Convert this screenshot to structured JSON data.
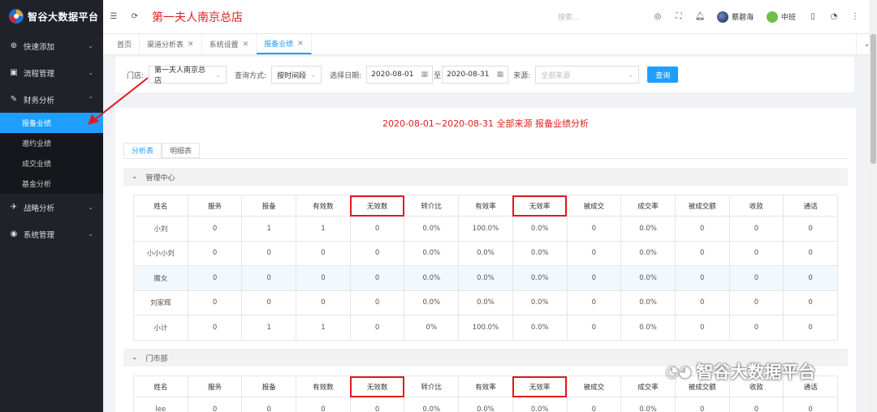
{
  "app": {
    "logo_text": "智谷大数据平台"
  },
  "sidebar": {
    "items": [
      {
        "label": "快速添加",
        "icon": "plus-circle-icon"
      },
      {
        "label": "流程管理",
        "icon": "camera-icon"
      },
      {
        "label": "财务分析",
        "icon": "edit-icon",
        "expanded": true,
        "children": [
          "报备业绩",
          "邀约业绩",
          "成交业绩",
          "基金分析"
        ],
        "active_child": "报备业绩"
      },
      {
        "label": "战略分析",
        "icon": "plane-icon"
      },
      {
        "label": "系统管理",
        "icon": "globe-icon"
      }
    ]
  },
  "header": {
    "store_title": "第一夫人南京总店",
    "search_placeholder": "搜索...",
    "user_name": "蔡碧海",
    "shift_label": "中班"
  },
  "tabs": [
    {
      "label": "首页",
      "closable": false,
      "active": false
    },
    {
      "label": "渠道分析表",
      "closable": true,
      "active": false
    },
    {
      "label": "系统设置",
      "closable": true,
      "active": false
    },
    {
      "label": "报备业绩",
      "closable": true,
      "active": true
    }
  ],
  "filter": {
    "store_label": "门店:",
    "store_value": "第一夫人南京总店",
    "query_mode_label": "查询方式:",
    "query_mode_value": "按时间段",
    "date_label": "选择日期:",
    "date_from": "2020-08-01",
    "date_to_sep": "至",
    "date_to": "2020-08-31",
    "source_label": "来源:",
    "source_placeholder": "全部来源",
    "query_button": "查询"
  },
  "report": {
    "title": "2020-08-01~2020-08-31 全部来源 报备业绩分析",
    "sub_tabs": [
      "分析表",
      "明细表"
    ],
    "active_sub_tab": "分析表",
    "columns": [
      "姓名",
      "服务",
      "报备",
      "有效数",
      "无效数",
      "转介比",
      "有效率",
      "无效率",
      "被成交",
      "成交率",
      "被成交额",
      "收款",
      "通话"
    ],
    "highlighted_columns": [
      "无效数",
      "无效率"
    ],
    "sections": [
      {
        "name": "管理中心",
        "rows": [
          [
            "小刘",
            "0",
            "1",
            "1",
            "0",
            "0.0%",
            "100.0%",
            "0.0%",
            "0",
            "0.0%",
            "0",
            "0",
            "0"
          ],
          [
            "小小小刘",
            "0",
            "0",
            "0",
            "0",
            "0.0%",
            "0.0%",
            "0.0%",
            "0",
            "0.0%",
            "0",
            "0",
            "0"
          ],
          [
            "魔女",
            "0",
            "0",
            "0",
            "0",
            "0.0%",
            "0.0%",
            "0.0%",
            "0",
            "0.0%",
            "0",
            "0",
            "0"
          ],
          [
            "刘家辉",
            "0",
            "0",
            "0",
            "0",
            "0.0%",
            "0.0%",
            "0.0%",
            "0",
            "0.0%",
            "0",
            "0",
            "0"
          ],
          [
            "小计",
            "0",
            "1",
            "1",
            "0",
            "0%",
            "100.0%",
            "0.0%",
            "0",
            "0.0%",
            "0",
            "0",
            "0"
          ]
        ]
      },
      {
        "name": "门市部",
        "rows": [
          [
            "lee",
            "0",
            "0",
            "0",
            "0",
            "0.0%",
            "0.0%",
            "0.0%",
            "0",
            "0.0%",
            "0",
            "0",
            "0"
          ]
        ]
      }
    ]
  },
  "watermark": {
    "text": "智谷大数据平台"
  },
  "colors": {
    "accent": "#1e9fff",
    "title_red": "#e02020",
    "sidebar_bg": "#20222a",
    "annotation_red": "#e0191e"
  }
}
